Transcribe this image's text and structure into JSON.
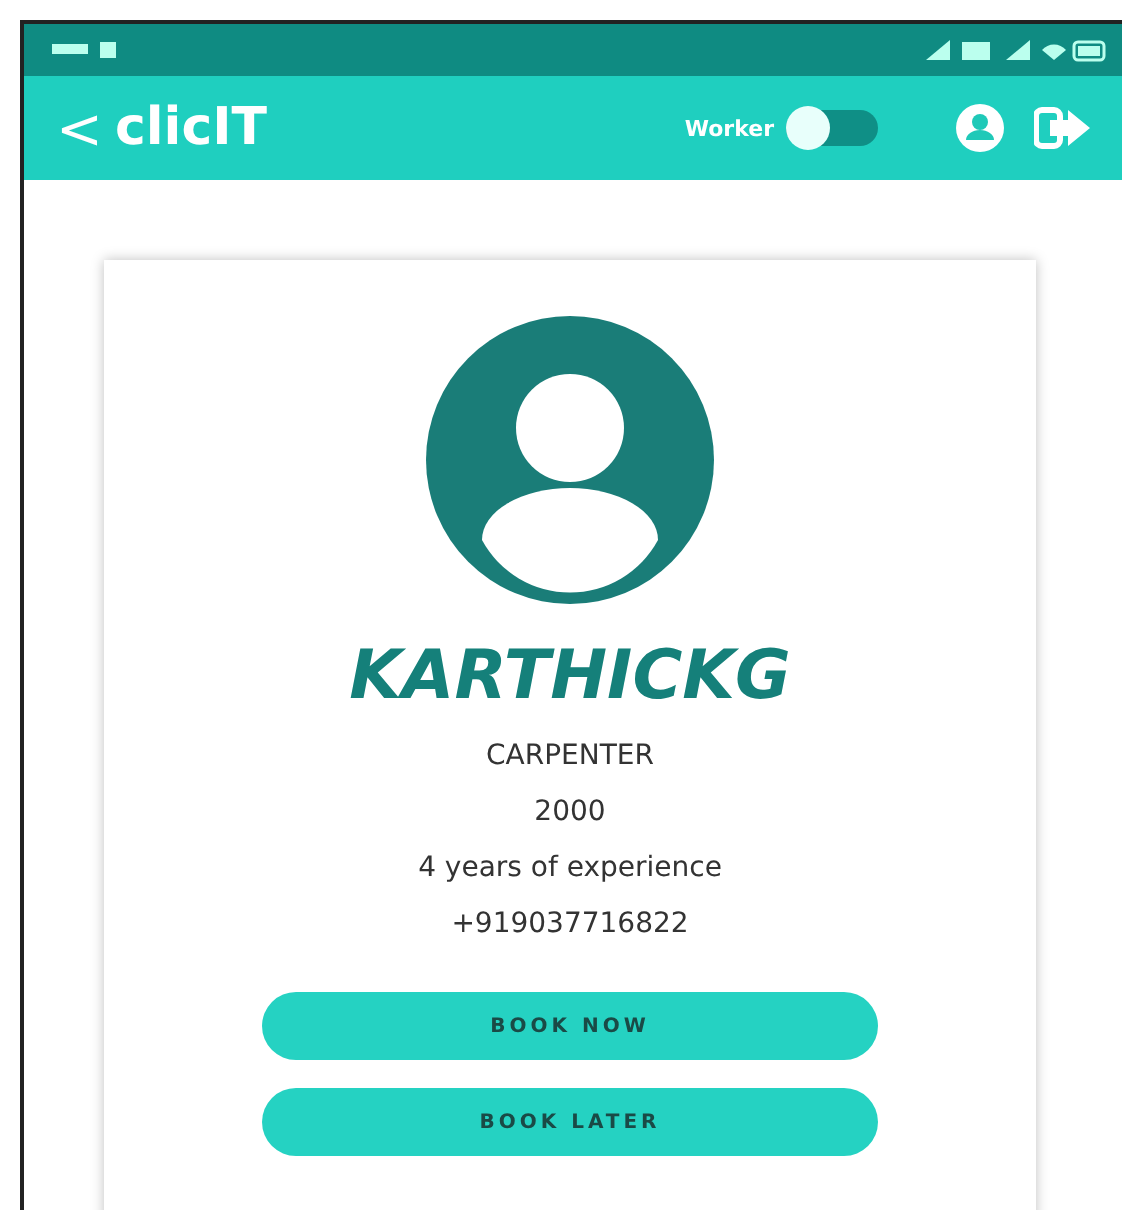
{
  "app_bar": {
    "back": "<",
    "title": "clicIT",
    "toggle_label": "Worker",
    "toggle_on": false
  },
  "profile": {
    "name": "KARTHICKG",
    "profession": "CARPENTER",
    "rate": "2000",
    "experience": "4 years of experience",
    "phone": "+919037716822"
  },
  "buttons": [
    "BOOK NOW",
    "BOOK LATER"
  ]
}
